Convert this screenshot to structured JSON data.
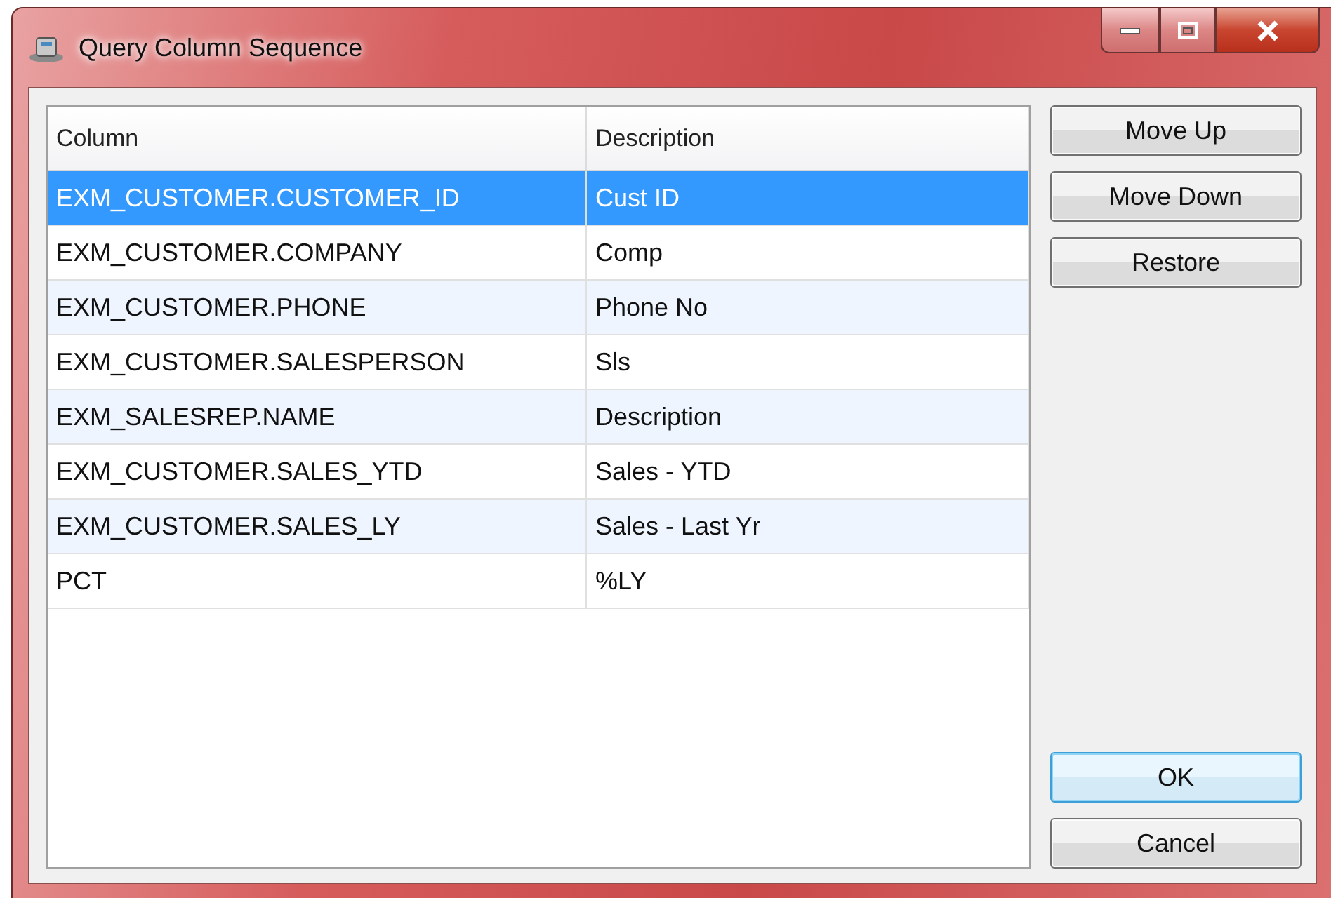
{
  "window": {
    "title": "Query Column Sequence"
  },
  "table": {
    "columns": [
      "Column",
      "Description"
    ],
    "rows": [
      {
        "cells": [
          "EXM_CUSTOMER.CUSTOMER_ID",
          "Cust ID"
        ],
        "selected": true
      },
      {
        "cells": [
          "EXM_CUSTOMER.COMPANY",
          "Comp"
        ],
        "selected": false
      },
      {
        "cells": [
          "EXM_CUSTOMER.PHONE",
          "Phone No"
        ],
        "selected": false
      },
      {
        "cells": [
          "EXM_CUSTOMER.SALESPERSON",
          "Sls"
        ],
        "selected": false
      },
      {
        "cells": [
          "EXM_SALESREP.NAME",
          "Description"
        ],
        "selected": false
      },
      {
        "cells": [
          "EXM_CUSTOMER.SALES_YTD",
          "Sales - YTD"
        ],
        "selected": false
      },
      {
        "cells": [
          "EXM_CUSTOMER.SALES_LY",
          "Sales - Last Yr"
        ],
        "selected": false
      },
      {
        "cells": [
          "PCT",
          "%LY"
        ],
        "selected": false
      }
    ]
  },
  "side_buttons": [
    "Move Up",
    "Move Down",
    "Restore"
  ],
  "dialog_buttons": [
    {
      "label": "OK",
      "default": true
    },
    {
      "label": "Cancel",
      "default": false
    }
  ]
}
